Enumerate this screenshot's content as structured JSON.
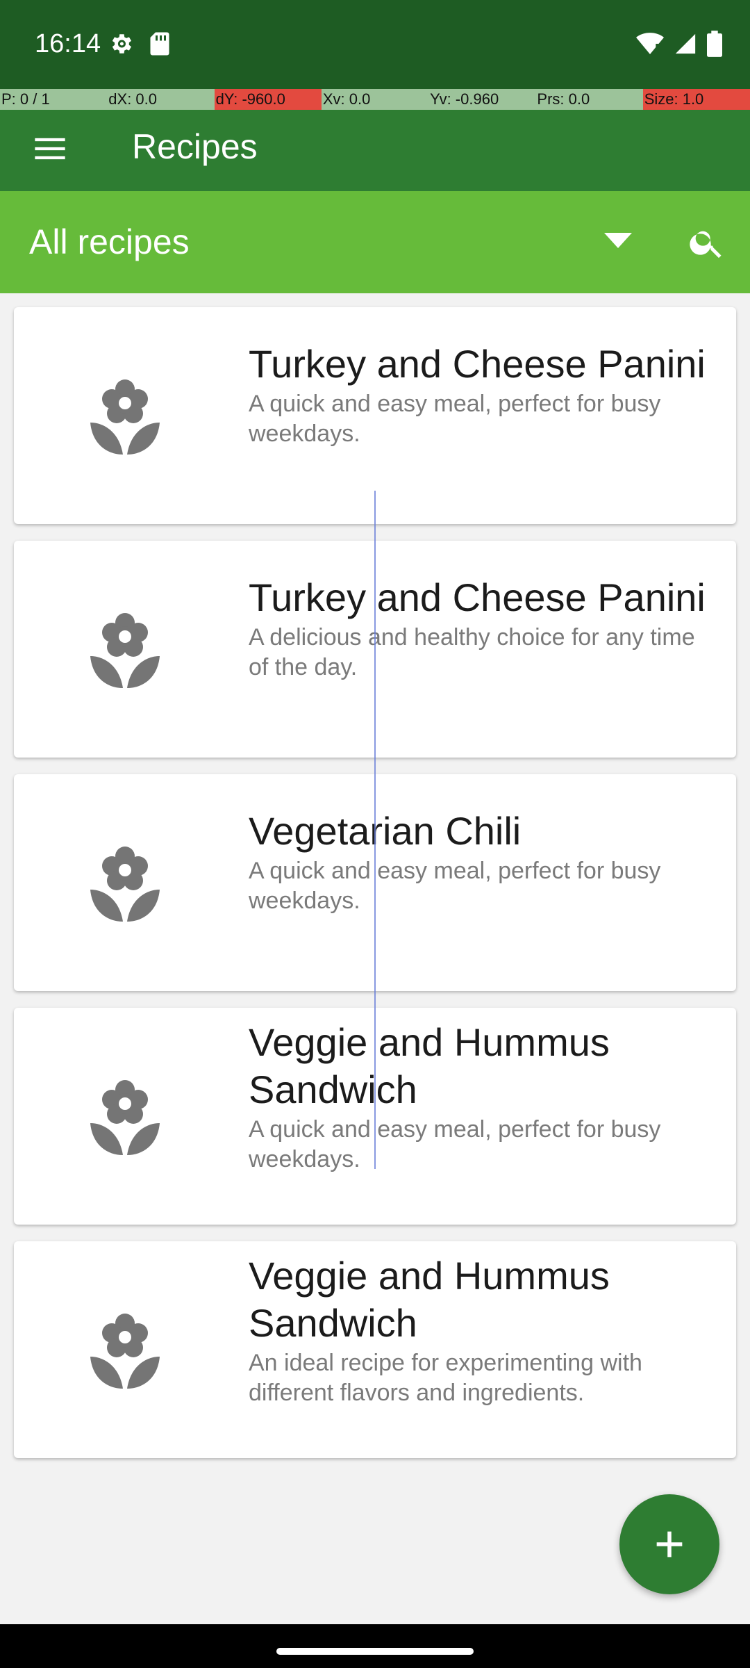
{
  "status_bar": {
    "time": "16:14",
    "icons": [
      "settings-icon",
      "sd-card-icon",
      "wifi-icon",
      "signal-icon",
      "battery-icon"
    ]
  },
  "debug_overlay": {
    "cells": [
      "P: 0 / 1",
      "dX: 0.0",
      "dY: -960.0",
      "Xv: 0.0",
      "Yv: -0.960",
      "Prs: 0.0",
      "Size: 1.0"
    ]
  },
  "app_bar": {
    "title": "Recipes",
    "menu_icon": "hamburger-menu-icon"
  },
  "filter": {
    "selected": "All recipes",
    "dropdown_icon": "dropdown-arrow-icon",
    "search_icon": "search-icon"
  },
  "recipes": [
    {
      "title": "Turkey and Cheese Panini",
      "description": "A quick and easy meal, perfect for busy weekdays.",
      "icon": "flower-icon"
    },
    {
      "title": "Turkey and Cheese Panini",
      "description": "A delicious and healthy choice for any time of the day.",
      "icon": "flower-icon"
    },
    {
      "title": "Vegetarian Chili",
      "description": "A quick and easy meal, perfect for busy weekdays.",
      "icon": "flower-icon"
    },
    {
      "title": "Veggie and Hummus Sandwich",
      "description": "A quick and easy meal, perfect for busy weekdays.",
      "icon": "flower-icon"
    },
    {
      "title": "Veggie and Hummus Sandwich",
      "description": "An ideal recipe for experimenting with different flavors and ingredients.",
      "icon": "flower-icon"
    }
  ],
  "fab": {
    "icon": "add-icon"
  },
  "colors": {
    "status_bar": "#1e5c23",
    "app_bar": "#2e7d32",
    "filter_bar": "#66bb3a",
    "fab": "#2e7d32"
  }
}
